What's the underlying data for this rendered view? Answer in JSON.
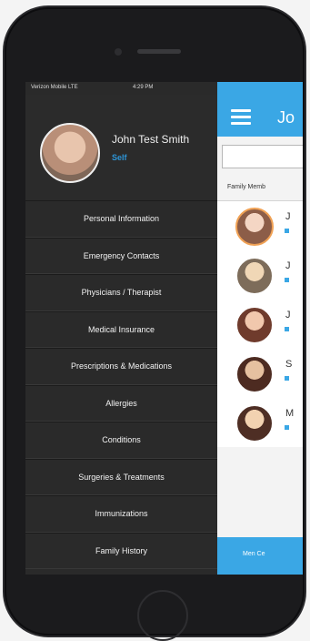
{
  "status": {
    "carrier": "Verizon Mobile LTE",
    "time": "4:29 PM"
  },
  "profile": {
    "name": "John Test Smith",
    "relation": "Self"
  },
  "menu": [
    "Personal Information",
    "Emergency Contacts",
    "Physicians / Therapist",
    "Medical Insurance",
    "Prescriptions & Medications",
    "Allergies",
    "Conditions",
    "Surgeries & Treatments",
    "Immunizations",
    "Family History"
  ],
  "panel": {
    "title": "Jo",
    "tab": "Family Memb",
    "members": [
      {
        "initial": "J",
        "colors": [
          "#f4d6c4",
          "#8c5d48"
        ]
      },
      {
        "initial": "J",
        "colors": [
          "#f0d7b6",
          "#7d6c5a"
        ]
      },
      {
        "initial": "J",
        "colors": [
          "#f1c8ad",
          "#6f3b2c"
        ]
      },
      {
        "initial": "S",
        "colors": [
          "#e6c1a0",
          "#4d2b21"
        ]
      },
      {
        "initial": "M",
        "colors": [
          "#f2d2b1",
          "#4e2e24"
        ]
      }
    ],
    "footer": "Men Ce"
  }
}
